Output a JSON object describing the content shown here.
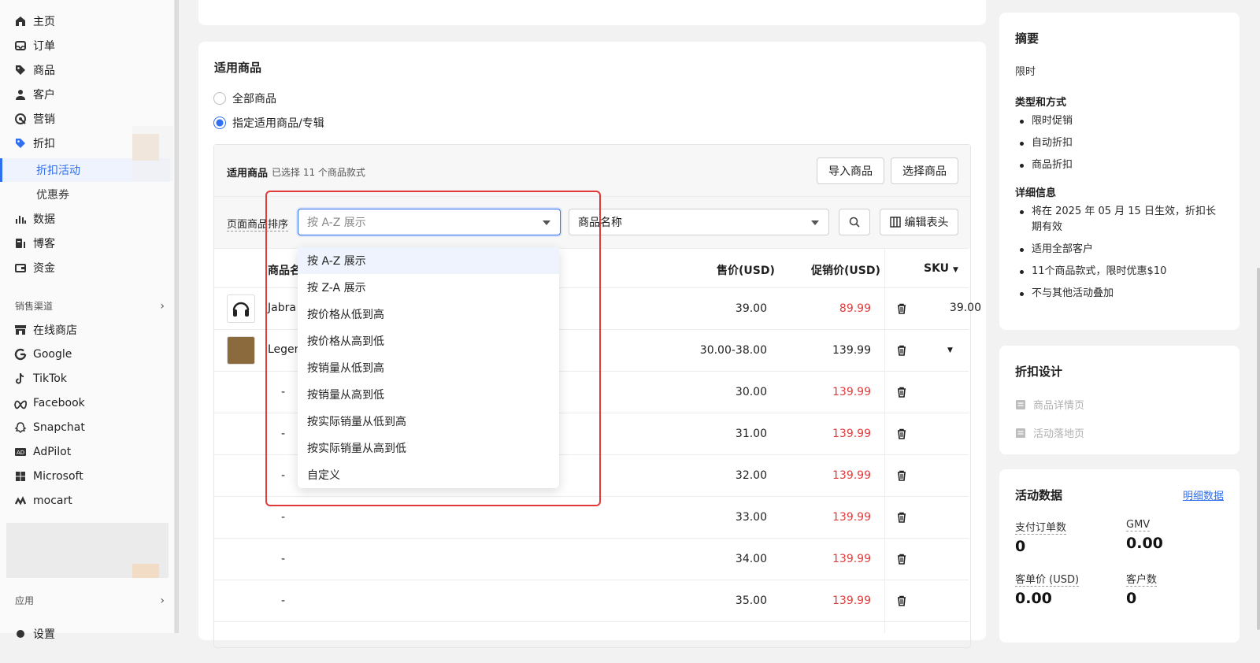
{
  "sidebar": {
    "items": [
      {
        "label": "主页",
        "icon": "home-icon"
      },
      {
        "label": "订单",
        "icon": "inbox-icon"
      },
      {
        "label": "商品",
        "icon": "tag-icon"
      },
      {
        "label": "客户",
        "icon": "person-icon"
      },
      {
        "label": "营销",
        "icon": "marketing-icon"
      },
      {
        "label": "折扣",
        "icon": "discount-icon"
      }
    ],
    "sub_items": [
      "折扣活动",
      "优惠券"
    ],
    "items2": [
      {
        "label": "数据",
        "icon": "chart-icon"
      },
      {
        "label": "博客",
        "icon": "blog-icon"
      },
      {
        "label": "资金",
        "icon": "wallet-icon"
      }
    ],
    "channels_header": "销售渠道",
    "channels": [
      {
        "label": "在线商店",
        "icon": "store-icon"
      },
      {
        "label": "Google",
        "icon": "google-icon"
      },
      {
        "label": "TikTok",
        "icon": "tiktok-icon"
      },
      {
        "label": "Facebook",
        "icon": "meta-icon"
      },
      {
        "label": "Snapchat",
        "icon": "snapchat-icon"
      },
      {
        "label": "AdPilot",
        "icon": "ad-icon"
      },
      {
        "label": "Microsoft",
        "icon": "microsoft-icon"
      },
      {
        "label": "mocart",
        "icon": "mocart-icon"
      }
    ],
    "apps_header": "应用",
    "settings_label": "设置"
  },
  "products_card": {
    "title": "适用商品",
    "radio_all": "全部商品",
    "radio_specific": "指定适用商品/专辑",
    "panel_title": "适用商品",
    "panel_selected": "已选择 11 个商品款式",
    "import_button": "导入商品",
    "select_button": "选择商品",
    "sort_label": "页面商品排序",
    "sort_placeholder": "按 A-Z 展示",
    "field_select": "商品名称",
    "edit_columns": "编辑表头",
    "columns": {
      "name": "商品名",
      "price": "售价(USD)",
      "promo": "促销价(USD)",
      "sku": "SKU"
    },
    "rows": [
      {
        "name": "Jabra",
        "price": "39.00",
        "promo": "89.99"
      },
      {
        "name": "Legen",
        "price": "30.00-38.00",
        "promo": "139.99"
      },
      {
        "name": "-",
        "price": "30.00",
        "promo": "139.99"
      },
      {
        "name": "-",
        "price": "31.00",
        "promo": "139.99"
      },
      {
        "name": "-",
        "price": "32.00",
        "promo": "139.99"
      },
      {
        "name": "-",
        "price": "33.00",
        "promo": "139.99"
      },
      {
        "name": "-",
        "price": "34.00",
        "promo": "139.99"
      },
      {
        "name": "-",
        "price": "35.00",
        "promo": "139.99"
      }
    ]
  },
  "sort_menu": {
    "options": [
      "按 A-Z 展示",
      "按 Z-A 展示",
      "按价格从低到高",
      "按价格从高到低",
      "按销量从低到高",
      "按销量从高到低",
      "按实际销量从低到高",
      "按实际销量从高到低",
      "自定义"
    ],
    "highlighted_index": 0
  },
  "summary": {
    "title": "摘要",
    "limit": "限时",
    "type_title": "类型和方式",
    "types": [
      "限时促销",
      "自动折扣",
      "商品折扣"
    ],
    "detail_title": "详细信息",
    "details": [
      "将在 2025 年 05 月 15 日生效，折扣长期有效",
      "适用全部客户",
      "11个商品款式，限时优惠$10",
      "不与其他活动叠加"
    ]
  },
  "design": {
    "title": "折扣设计",
    "items": [
      "商品详情页",
      "活动落地页"
    ]
  },
  "activity": {
    "title": "活动数据",
    "link": "明细数据",
    "stats": [
      {
        "label": "支付订单数",
        "value": "0"
      },
      {
        "label": "GMV",
        "value": "0.00"
      },
      {
        "label": "客单价 (USD)",
        "value": "0.00"
      },
      {
        "label": "客户数",
        "value": "0"
      }
    ]
  },
  "colors": {
    "accent": "#2f6ff0",
    "promo_red": "#e23a3a",
    "highlight_box": "#e03a3a"
  }
}
